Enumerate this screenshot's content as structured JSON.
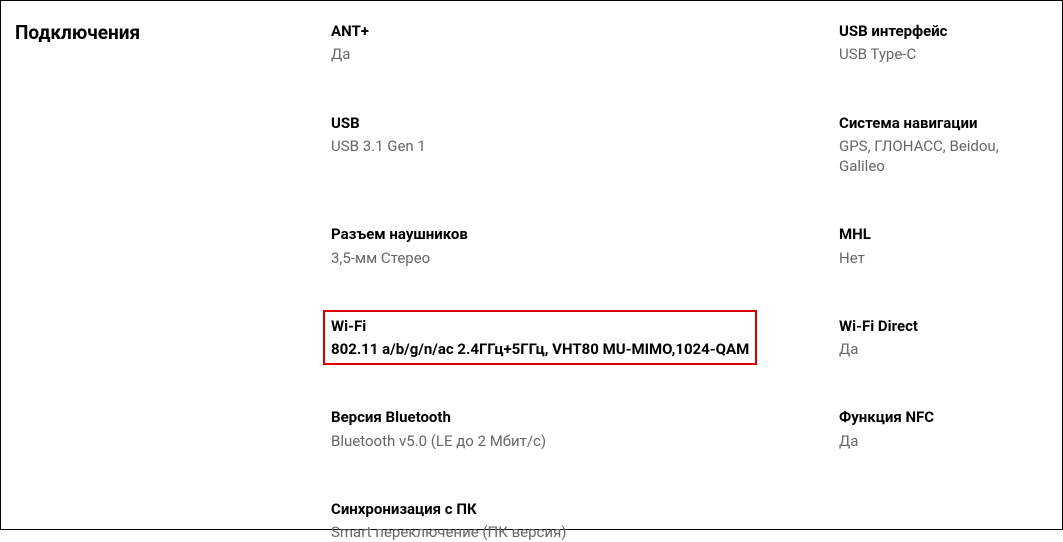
{
  "section": {
    "title": "Подключения"
  },
  "specs": {
    "ant_plus": {
      "label": "ANT+",
      "value": "Да"
    },
    "usb_interface": {
      "label": "USB интерфейс",
      "value": "USB Type-C"
    },
    "usb": {
      "label": "USB",
      "value": "USB 3.1 Gen 1"
    },
    "navigation": {
      "label": "Система навигации",
      "value": "GPS, ГЛОНАСС, Beidou, Galileo"
    },
    "headphone_jack": {
      "label": "Разъем наушников",
      "value": "3,5-мм Стерео"
    },
    "mhl": {
      "label": "MHL",
      "value": "Нет"
    },
    "wifi": {
      "label": "Wi-Fi",
      "value": "802.11 a/b/g/n/ac 2.4ГГц+5ГГц, VHT80 MU-MIMO,1024-QAM"
    },
    "wifi_direct": {
      "label": "Wi-Fi Direct",
      "value": "Да"
    },
    "bluetooth": {
      "label": "Версия Bluetooth",
      "value": "Bluetooth v5.0 (LE до 2 Мбит/с)"
    },
    "nfc": {
      "label": "Функция NFC",
      "value": "Да"
    },
    "pc_sync": {
      "label": "Синхронизация с ПК",
      "value": "Smart переключение (ПК версия)"
    }
  }
}
